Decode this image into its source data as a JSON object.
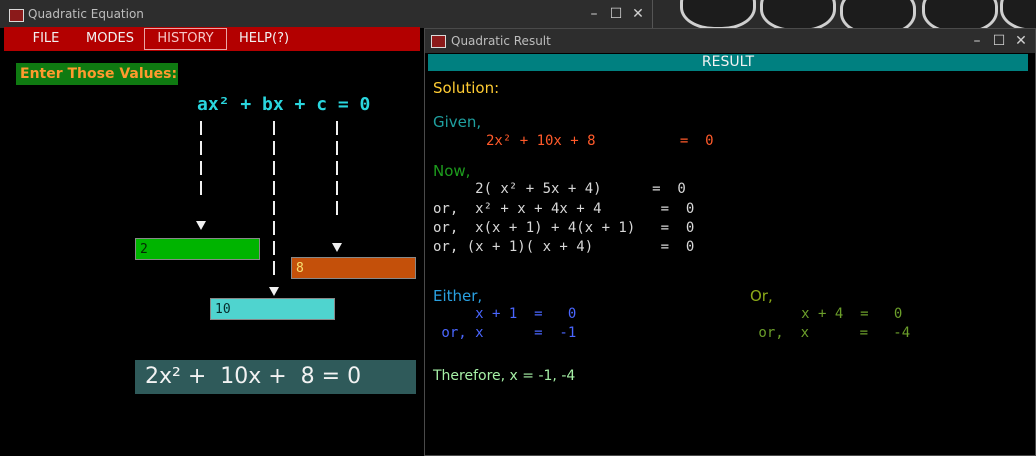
{
  "main_window": {
    "title": "Quadratic Equation",
    "menu": [
      "FILE",
      "MODES",
      "HISTORY",
      "HELP(?)"
    ],
    "prompt": "Enter Those Values:",
    "equation_template": "ax² + bx + c = 0",
    "inputs": {
      "a": "2",
      "b": "10",
      "c": "8"
    },
    "equation_display": "2x² +  10x +  8 = 0"
  },
  "result_window": {
    "title": "Quadratic Result",
    "header": "RESULT",
    "solution_label": "Solution:",
    "given_label": "Given,",
    "given_eq": "2x² + 10x + 8          =  0",
    "now_label": "Now,",
    "steps": [
      "     2( x² + 5x + 4)      =  0",
      "or,  x² + x + 4x + 4       =  0",
      "or,  x(x + 1) + 4(x + 1)   =  0",
      "or, (x + 1)( x + 4)        =  0"
    ],
    "either_label": "Either,",
    "either_lines": [
      "     x + 1  =   0",
      " or, x      =  -1"
    ],
    "or_label": "Or,",
    "or_lines": [
      "     x + 4  =   0",
      " or,  x      =   -4"
    ],
    "therefore": "Therefore, x = -1, -4"
  },
  "colors": {
    "menu_bg": "#b30000",
    "result_header_bg": "#008080",
    "input_a": "#00b400",
    "input_b": "#4fd4cf",
    "input_c": "#c4500a"
  },
  "icons": [
    "window-app-icon",
    "minimize-icon",
    "maximize-icon",
    "close-icon",
    "down-arrow-icon"
  ]
}
